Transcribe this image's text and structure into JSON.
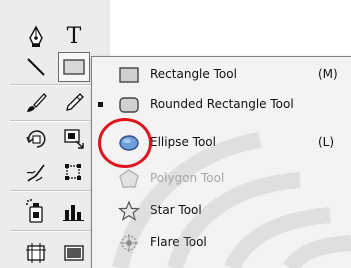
{
  "toolbox": {
    "tools": [
      {
        "name": "pen-tool",
        "icon": "pen-icon"
      },
      {
        "name": "type-tool",
        "icon": "type-icon",
        "label": "T"
      },
      {
        "name": "line-segment-tool",
        "icon": "line-icon"
      },
      {
        "name": "rectangle-tool",
        "icon": "rectangle-icon",
        "active": true
      },
      {
        "name": "paintbrush-tool",
        "icon": "brush-icon"
      },
      {
        "name": "pencil-tool",
        "icon": "pencil-icon"
      },
      {
        "name": "rotate-tool",
        "icon": "rotate-icon"
      },
      {
        "name": "scale-tool",
        "icon": "scale-icon"
      },
      {
        "name": "warp-tool",
        "icon": "warp-icon"
      },
      {
        "name": "free-transform-tool",
        "icon": "free-transform-icon"
      },
      {
        "name": "symbol-sprayer-tool",
        "icon": "symbol-sprayer-icon"
      },
      {
        "name": "column-graph-tool",
        "icon": "graph-icon"
      },
      {
        "name": "artboard-tool",
        "icon": "artboard-icon"
      },
      {
        "name": "slice-tool",
        "icon": "slice-icon"
      }
    ]
  },
  "flyout": {
    "items": [
      {
        "label": "Rectangle Tool",
        "shortcut": "(M)",
        "icon": "rectangle-icon",
        "checked": false,
        "enabled": true
      },
      {
        "label": "Rounded Rectangle Tool",
        "shortcut": "",
        "icon": "rounded-rectangle-icon",
        "checked": true,
        "enabled": true
      },
      {
        "label": "Ellipse Tool",
        "shortcut": "(L)",
        "icon": "ellipse-icon",
        "checked": false,
        "enabled": true,
        "highlighted": true
      },
      {
        "label": "Polygon Tool",
        "shortcut": "",
        "icon": "polygon-icon",
        "checked": false,
        "enabled": false
      },
      {
        "label": "Star Tool",
        "shortcut": "",
        "icon": "star-icon",
        "checked": false,
        "enabled": true
      },
      {
        "label": "Flare Tool",
        "shortcut": "",
        "icon": "flare-icon",
        "checked": false,
        "enabled": true
      }
    ]
  },
  "colors": {
    "highlight_circle": "#e0141c",
    "menu_background": "#f3f3f3",
    "toolbox_background": "#ececec",
    "ellipse_fill": "#6f9fd8"
  }
}
